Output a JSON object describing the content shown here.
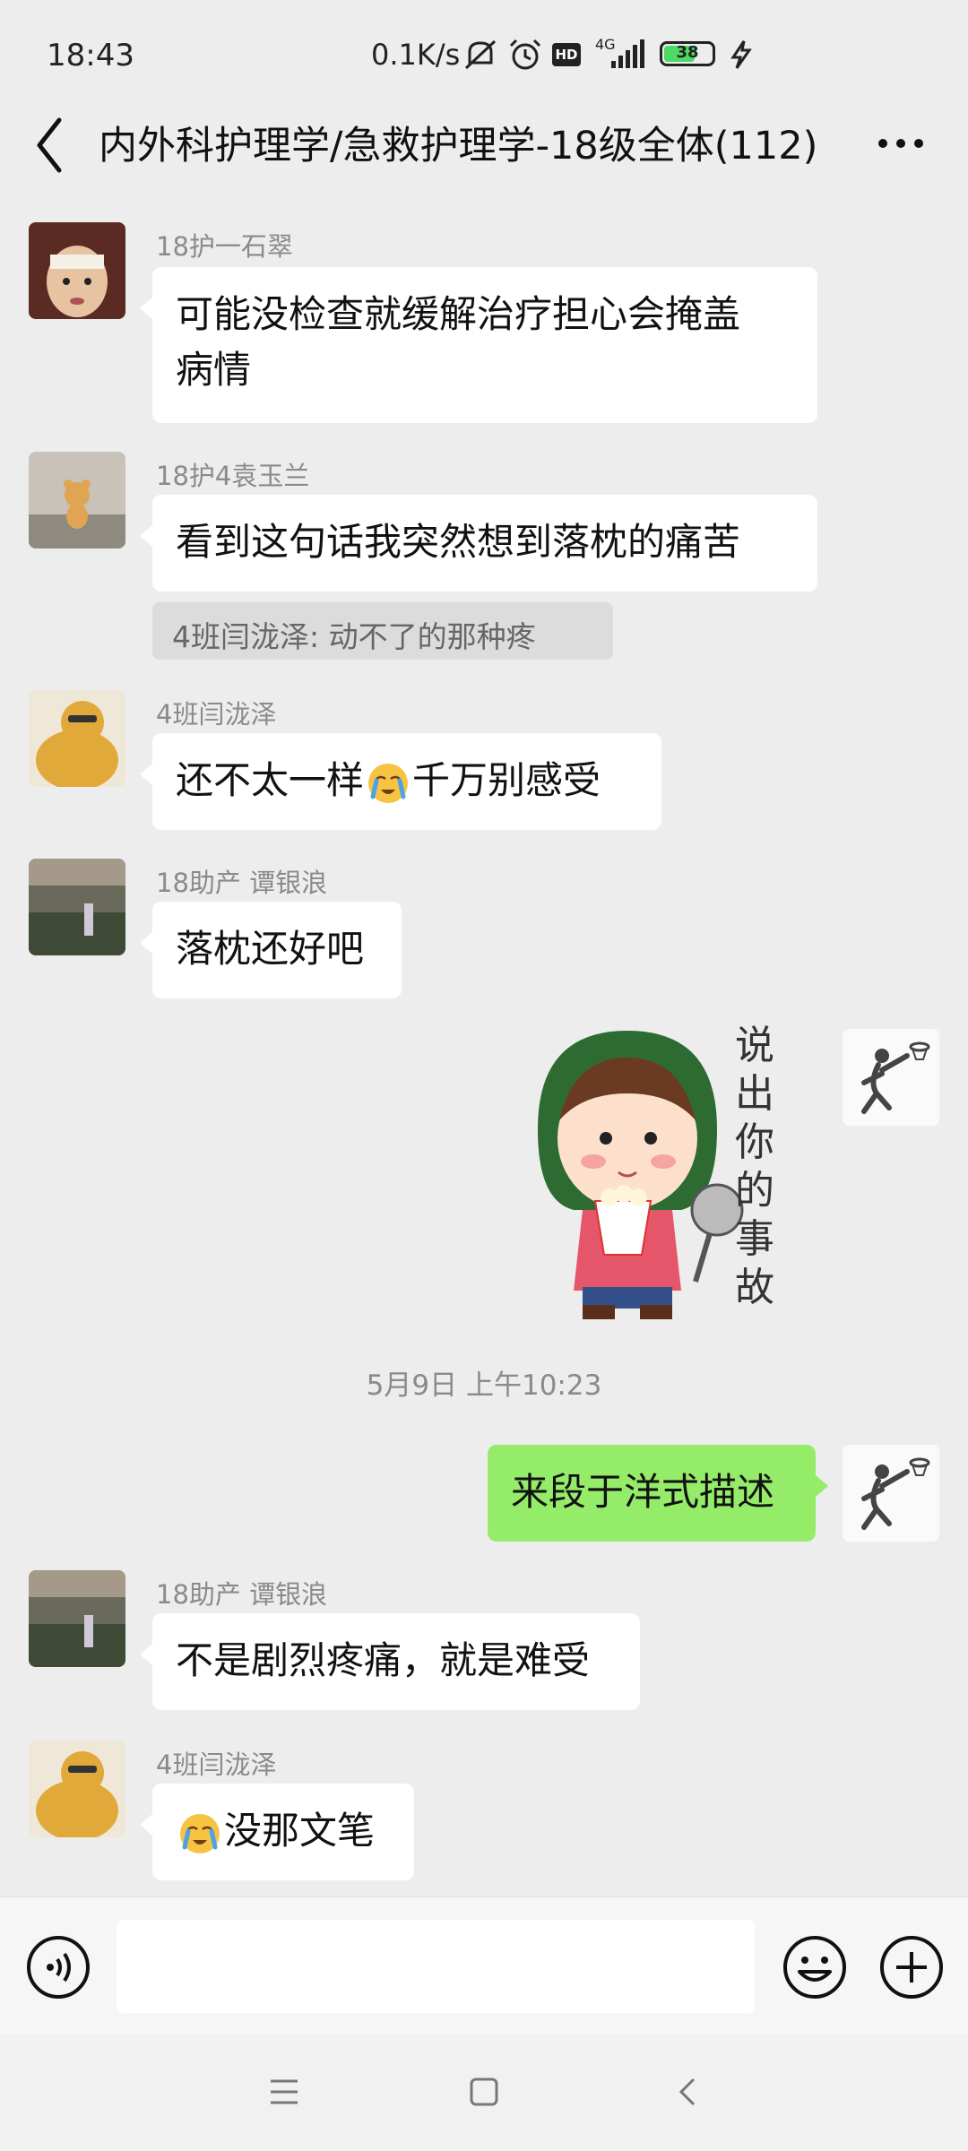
{
  "status_bar": {
    "time": "18:43",
    "network_speed": "0.1K/s",
    "hd_label": "HD",
    "signal_label": "4G",
    "battery": "38"
  },
  "header": {
    "title": "内外科护理学/急救护理学-18级全体(112)"
  },
  "messages": [
    {
      "sender": "18护一石翠",
      "text": "可能没检查就缓解治疗担心会掩盖病情",
      "line1": "可能没检查就缓解治疗担心会掩盖",
      "line2": "病情"
    },
    {
      "sender": "18护4袁玉兰",
      "text": "看到这句话我突然想到落枕的痛苦",
      "quote": "4班闫泷泽: 动不了的那种疼"
    },
    {
      "sender": "4班闫泷泽",
      "text_before": "还不太一样",
      "text_after": "千万别感受"
    },
    {
      "sender": "18助产  谭银浪",
      "text": "落枕还好吧"
    },
    {
      "sticker_text": "说出你的事故"
    },
    {
      "timestamp": "5月9日 上午10:23"
    },
    {
      "text": "来段于洋式描述",
      "outgoing": true
    },
    {
      "sender": "18助产  谭银浪",
      "text": "不是剧烈疼痛，就是难受"
    },
    {
      "sender": "4班闫泷泽",
      "text_after": "没那文笔"
    }
  ],
  "sticker": {
    "chars": [
      "说",
      "出",
      "你",
      "的",
      "事",
      "故"
    ]
  },
  "icons": [
    "back-icon",
    "more-icon",
    "voice-icon",
    "emoji-icon",
    "plus-icon",
    "menu-nav-icon",
    "home-nav-icon",
    "back-nav-icon"
  ],
  "colors": {
    "outgoing_bubble": "#95ec69",
    "background": "#ededed"
  }
}
